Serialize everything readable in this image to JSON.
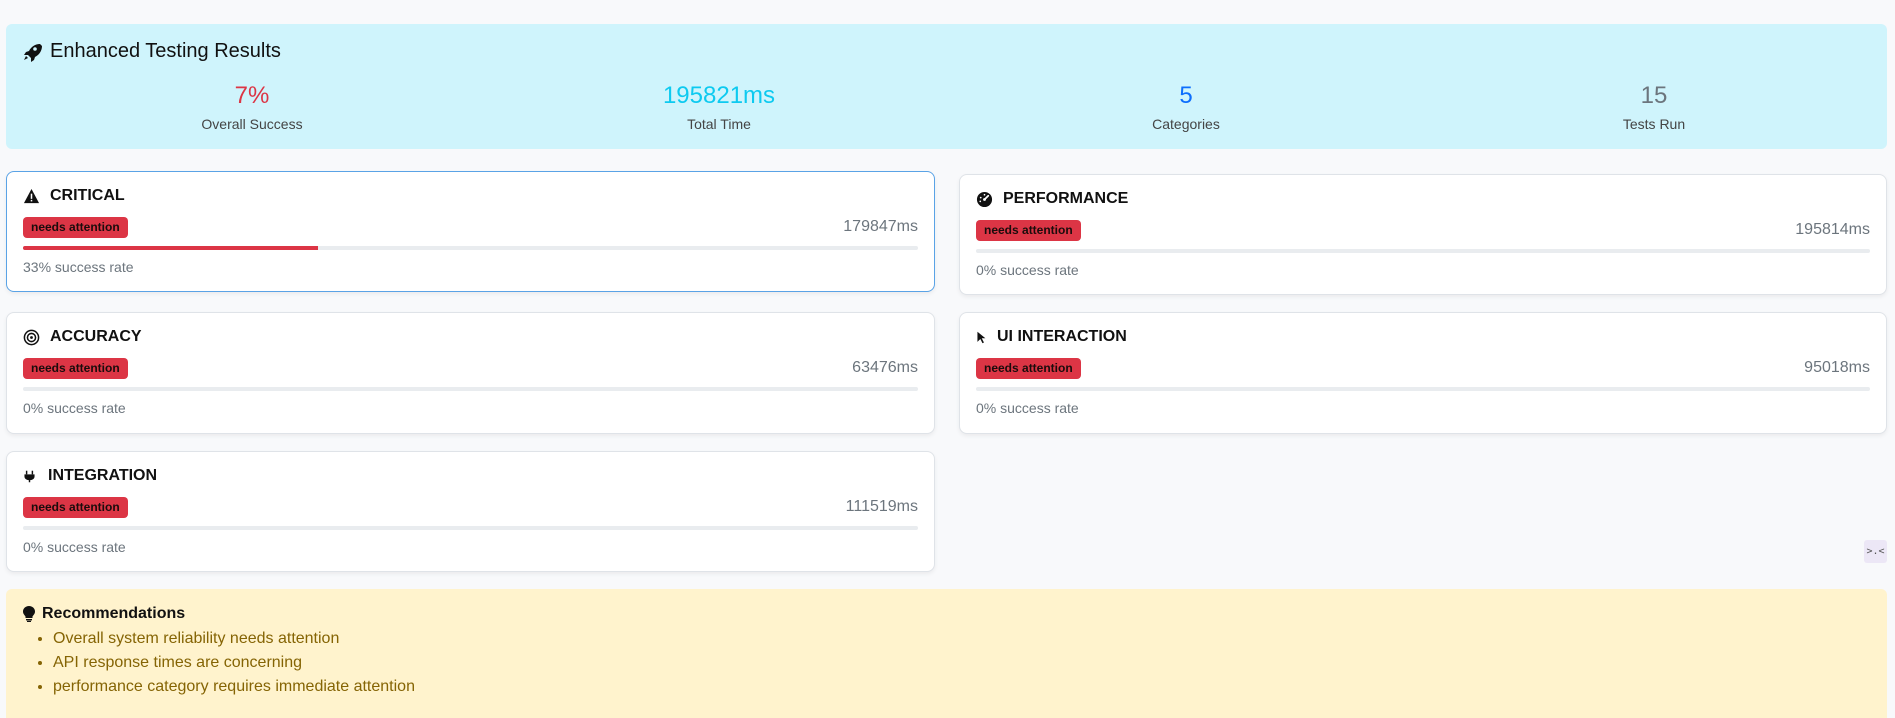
{
  "summary": {
    "title": "Enhanced Testing Results",
    "stats": [
      {
        "value": "7%",
        "label": "Overall Success",
        "color": "#dc3545"
      },
      {
        "value": "195821ms",
        "label": "Total Time",
        "color": "#0dcaf0"
      },
      {
        "value": "5",
        "label": "Categories",
        "color": "#0d6efd"
      },
      {
        "value": "15",
        "label": "Tests Run",
        "color": "#6c757d"
      }
    ]
  },
  "categories": [
    {
      "name": "CRITICAL",
      "icon": "warning-icon",
      "status": "needs attention",
      "duration": "179847ms",
      "success": 33,
      "rate_text": "33% success rate"
    },
    {
      "name": "PERFORMANCE",
      "icon": "speedometer-icon",
      "status": "needs attention",
      "duration": "195814ms",
      "success": 0,
      "rate_text": "0% success rate"
    },
    {
      "name": "ACCURACY",
      "icon": "target-icon",
      "status": "needs attention",
      "duration": "63476ms",
      "success": 0,
      "rate_text": "0% success rate"
    },
    {
      "name": "UI INTERACTION",
      "icon": "cursor-icon",
      "status": "needs attention",
      "duration": "95018ms",
      "success": 0,
      "rate_text": "0% success rate"
    },
    {
      "name": "INTEGRATION",
      "icon": "plug-icon",
      "status": "needs attention",
      "duration": "111519ms",
      "success": 0,
      "rate_text": "0% success rate"
    }
  ],
  "recommendations": {
    "title": "Recommendations",
    "items": [
      "Overall system reliability needs attention",
      "API response times are concerning",
      "performance category requires immediate attention"
    ]
  },
  "toggle_label": ">.<"
}
